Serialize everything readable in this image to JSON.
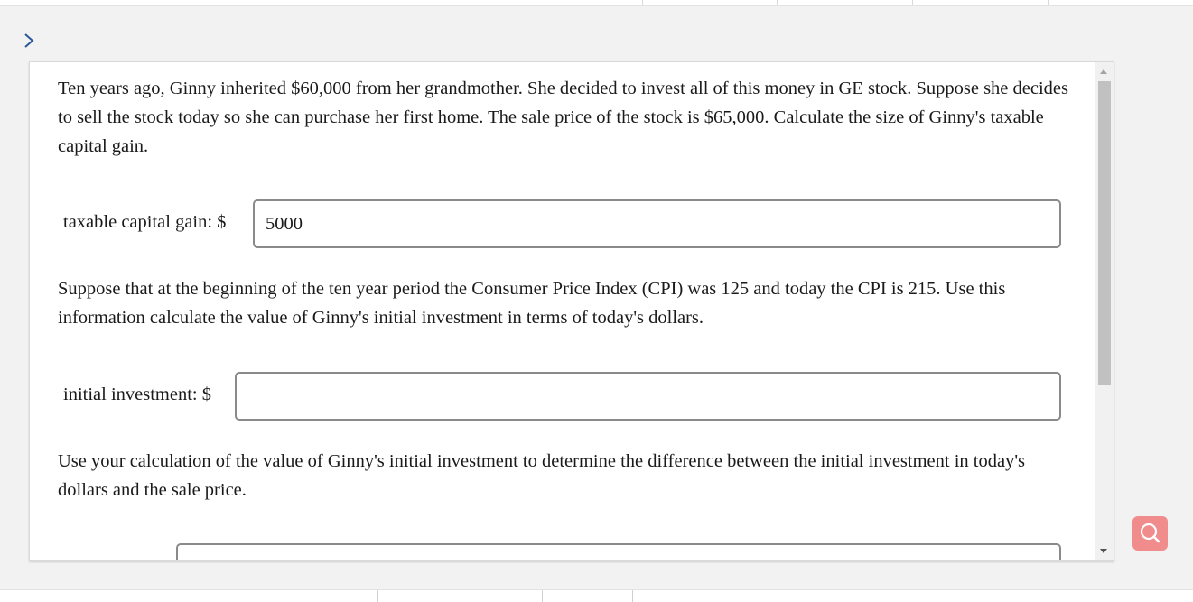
{
  "question": {
    "intro": "Ten years ago, Ginny inherited $60,000 from her grandmother. She decided to invest all of this money in GE stock. Suppose she decides to sell the stock today so she can purchase her first home. The sale price of the stock is $65,000. Calculate the size of Ginny's taxable capital gain.",
    "gain_label": "taxable capital gain: $",
    "gain_value": "5000",
    "cpi_text": "Suppose that at the beginning of the ten year period the Consumer Price Index (CPI) was 125 and today the CPI is 215. Use this information calculate the value of Ginny's initial investment in terms of today's dollars.",
    "initial_label": "initial investment: $",
    "initial_value": "",
    "difference_text": "Use your calculation of the value of Ginny's initial investment to determine the difference between the initial investment in today's dollars and the sale price."
  },
  "icons": {
    "expand": "chevron-right-icon",
    "search": "search-icon"
  },
  "colors": {
    "search_button": "#f08c8c",
    "field_border": "#8a8a8a",
    "background": "#f2f2f2"
  }
}
